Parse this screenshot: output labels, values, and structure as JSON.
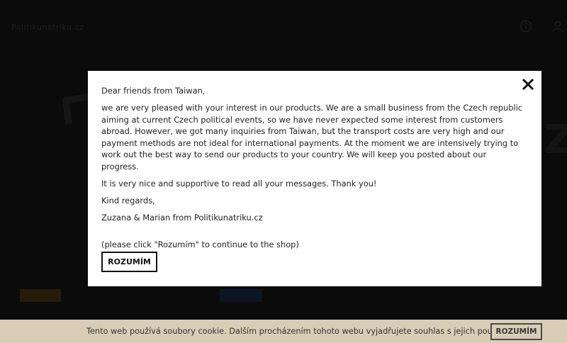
{
  "site": {
    "logo_text": "Politikunatriku.cz",
    "icons": [
      "info-icon",
      "user-icon"
    ]
  },
  "modal": {
    "greeting": "Dear friends from Taiwan,",
    "paragraph_main": "we are very pleased with your interest in our products. We are a small business from the Czech republic aiming at current Czech political events, so we have never expected some interest from customers abroad. However, we got many inquiries from Taiwan, but the transport costs are very high and our payment methods are not ideal for international payments. At the moment we are intensively trying to work out the best way to send our products to your country. We will keep you posted about our progress.",
    "paragraph_thanks": "It is very nice and supportive to read all your messages. Thank you!",
    "closing": "Kind regards,",
    "signature": "Zuzana & Marian from Politikunatriku.cz",
    "instruction": "(please click \"Rozumím\" to continue to the shop)",
    "button_label": "ROZUMÍM",
    "close_icon": "close-icon"
  },
  "cookie_bar": {
    "text": "Tento web používá soubory cookie. Dalším procházením tohoto webu vyjadřujete souhlas s jejich používáním.",
    "button_label": "ROZUMÍM"
  }
}
